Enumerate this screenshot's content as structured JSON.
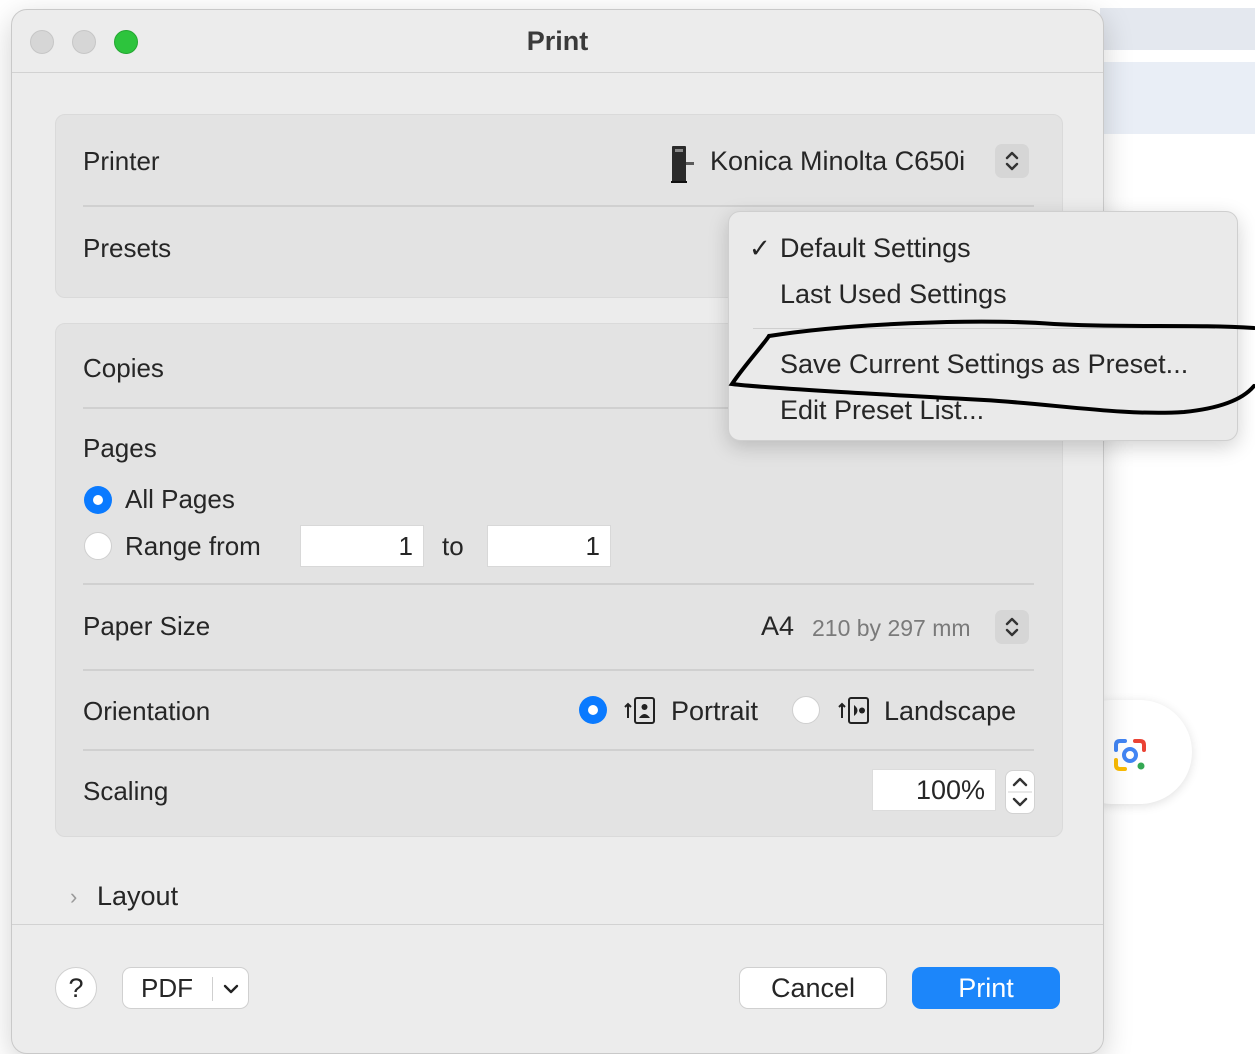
{
  "window": {
    "title": "Print"
  },
  "printer": {
    "label": "Printer",
    "value": "Konica Minolta C650i"
  },
  "presets": {
    "label": "Presets",
    "menu": {
      "items": [
        {
          "label": "Default Settings",
          "checked": true
        },
        {
          "label": "Last Used Settings",
          "checked": false
        },
        {
          "label": "Save Current Settings as Preset...",
          "checked": false
        },
        {
          "label": "Edit Preset List...",
          "checked": false
        }
      ],
      "check_mark": "✓"
    }
  },
  "copies": {
    "label": "Copies"
  },
  "pages": {
    "label": "Pages",
    "all_pages": "All Pages",
    "range_from": "Range from",
    "from_value": "1",
    "to_label": "to",
    "to_value": "1",
    "selected": "All Pages"
  },
  "paper_size": {
    "label": "Paper Size",
    "value": "A4",
    "dimensions": "210 by 297 mm"
  },
  "orientation": {
    "label": "Orientation",
    "portrait": "Portrait",
    "landscape": "Landscape",
    "selected": "Portrait"
  },
  "scaling": {
    "label": "Scaling",
    "value": "100%"
  },
  "layout": {
    "label": "Layout",
    "chevron": "›"
  },
  "footer": {
    "help": "?",
    "pdf": "PDF",
    "cancel": "Cancel",
    "print": "Print"
  },
  "colors": {
    "accent": "#1c86fa",
    "radio_on": "#0a7aff",
    "zoom_button": "#2dc43d",
    "annotation": "#000000"
  },
  "icons": [
    "printer-icon",
    "up-down-chevron-icon",
    "portrait-orientation-icon",
    "landscape-orientation-icon",
    "chevron-down-icon",
    "lens-camera-icon"
  ]
}
